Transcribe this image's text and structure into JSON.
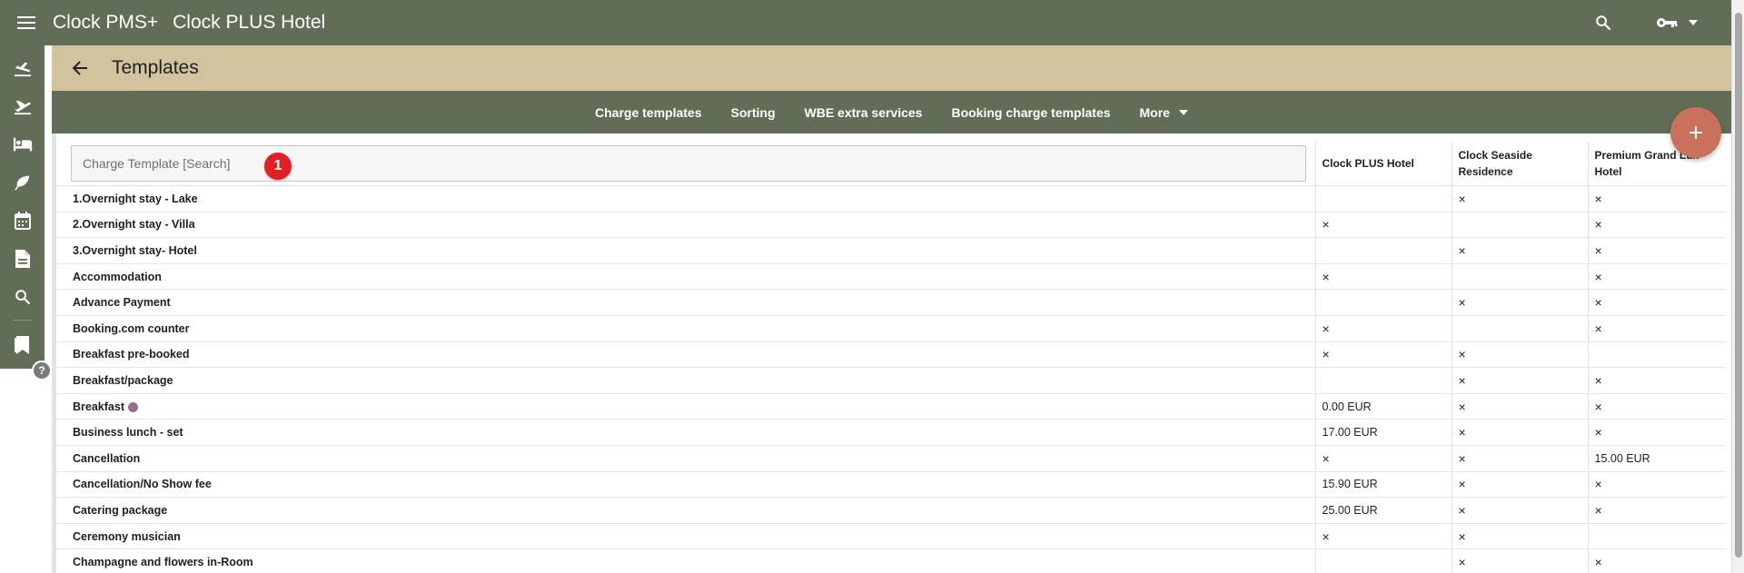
{
  "topbar": {
    "app_title": "Clock PMS+",
    "hotel_name": "Clock PLUS Hotel"
  },
  "header": {
    "title": "Templates"
  },
  "subnav": {
    "items": [
      "Charge templates",
      "Sorting",
      "WBE extra services",
      "Booking charge templates"
    ],
    "more_label": "More"
  },
  "rail": {
    "icons": [
      "arrivals-icon",
      "departures-icon",
      "rooms-icon",
      "housekeeping-icon",
      "calendar-icon",
      "reports-icon",
      "search-icon",
      "bookmark-icon"
    ],
    "help_label": "?"
  },
  "search": {
    "placeholder": "Charge Template [Search]",
    "step_marker": "1"
  },
  "table": {
    "columns": [
      "Clock PLUS Hotel",
      "Clock Seaside Residence",
      "Premium Grand Lux Hotel"
    ],
    "rows": [
      {
        "name": "1.Overnight stay - Lake",
        "cells": [
          "",
          "×",
          "×"
        ]
      },
      {
        "name": "2.Overnight stay - Villa",
        "cells": [
          "×",
          "",
          "×"
        ]
      },
      {
        "name": "3.Overnight stay- Hotel",
        "cells": [
          "",
          "×",
          "×"
        ]
      },
      {
        "name": "Accommodation",
        "cells": [
          "×",
          "",
          "×"
        ]
      },
      {
        "name": "Advance Payment",
        "cells": [
          "",
          "×",
          "×"
        ]
      },
      {
        "name": "Booking.com counter",
        "cells": [
          "×",
          "",
          "×"
        ]
      },
      {
        "name": "Breakfast pre-booked",
        "cells": [
          "×",
          "×",
          ""
        ]
      },
      {
        "name": "Breakfast/package",
        "cells": [
          "",
          "×",
          "×"
        ]
      },
      {
        "name": "Breakfast",
        "cells": [
          "0.00 EUR",
          "×",
          "×"
        ]
      },
      {
        "name": "Business lunch - set",
        "cells": [
          "17.00 EUR",
          "×",
          "×"
        ]
      },
      {
        "name": "Cancellation",
        "cells": [
          "×",
          "×",
          "15.00 EUR"
        ]
      },
      {
        "name": "Cancellation/No Show fee",
        "cells": [
          "15.90 EUR",
          "×",
          "×"
        ]
      },
      {
        "name": "Catering package",
        "cells": [
          "25.00 EUR",
          "×",
          "×"
        ]
      },
      {
        "name": "Ceremony musician",
        "cells": [
          "×",
          "×",
          ""
        ]
      },
      {
        "name": "Champagne and flowers in-Room",
        "cells": [
          "",
          "×",
          "×"
        ]
      }
    ]
  },
  "colors": {
    "topbar": "#616d56",
    "headband": "#d2c39f",
    "fab": "#c9715c",
    "marker": "#e31f26"
  }
}
